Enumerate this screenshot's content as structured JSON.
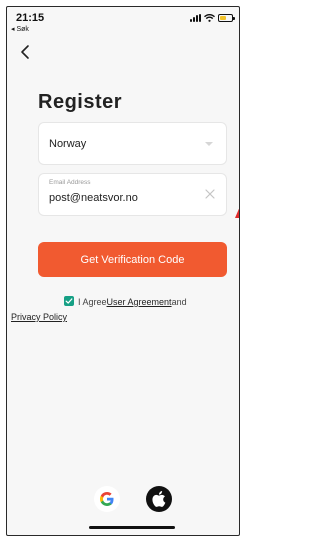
{
  "status_bar": {
    "time": "21:15",
    "back_app": "◂ Søk",
    "battery_color": "#f2c32a"
  },
  "nav": {
    "back_icon": "chevron-left-icon"
  },
  "page": {
    "title": "Register"
  },
  "form": {
    "country": {
      "value": "Norway"
    },
    "email": {
      "label": "Email Address",
      "value": "post@neatsvor.no"
    },
    "submit_label": "Get Verification Code",
    "accent_color": "#f15a30"
  },
  "agreement": {
    "checked": true,
    "prefix": "I Agree",
    "user_agreement": "User Agreement",
    "conjunction": "and",
    "privacy_policy": "Privacy Policy"
  },
  "social": {
    "google_icon": "google-icon",
    "apple_icon": "apple-icon"
  }
}
